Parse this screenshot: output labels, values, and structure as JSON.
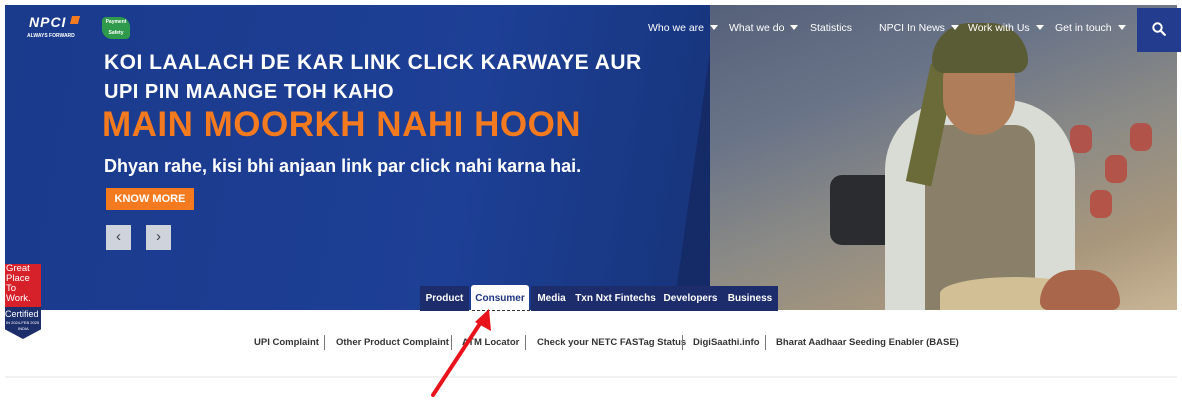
{
  "header": {
    "logo_text": "NPCI",
    "logo_tagline": "ALWAYS FORWARD",
    "badge_text": "Payment Safety",
    "nav": [
      {
        "label": "Who we are",
        "dropdown": true
      },
      {
        "label": "What we do",
        "dropdown": true
      },
      {
        "label": "Statistics",
        "dropdown": false
      },
      {
        "label": "NPCI In News",
        "dropdown": true
      },
      {
        "label": "Work with Us",
        "dropdown": true
      },
      {
        "label": "Get in touch",
        "dropdown": true
      }
    ],
    "search_icon": "search-icon"
  },
  "hero": {
    "line1": "KOI LAALACH DE KAR LINK CLICK KARWAYE AUR",
    "line2": "UPI PIN MAANGE TOH KAHO",
    "headline": "MAIN MOORKH NAHI HOON",
    "subline": "Dhyan rahe, kisi bhi anjaan link par click nahi karna hai.",
    "cta_label": "KNOW MORE",
    "prev_label": "‹",
    "next_label": "›",
    "accent_color": "#f47a1f"
  },
  "certification": {
    "line1": "Great",
    "line2": "Place",
    "line3": "To",
    "line4": "Work.",
    "certified": "Certified",
    "dates": "IN 2024-FEB 2025",
    "country": "INDIA"
  },
  "tabs": [
    {
      "label": "Product",
      "active": false
    },
    {
      "label": "Consumer",
      "active": true
    },
    {
      "label": "Media",
      "active": false
    },
    {
      "label": "Txn Nxt Fintechs",
      "active": false
    },
    {
      "label": "Developers",
      "active": false
    },
    {
      "label": "Business",
      "active": false
    }
  ],
  "consumer_links": [
    "UPI Complaint",
    "Other Product Complaint",
    "ATM Locator",
    "Check your NETC FASTag Status",
    "DigiSaathi.info",
    "Bharat Aadhaar Seeding Enabler (BASE)"
  ]
}
